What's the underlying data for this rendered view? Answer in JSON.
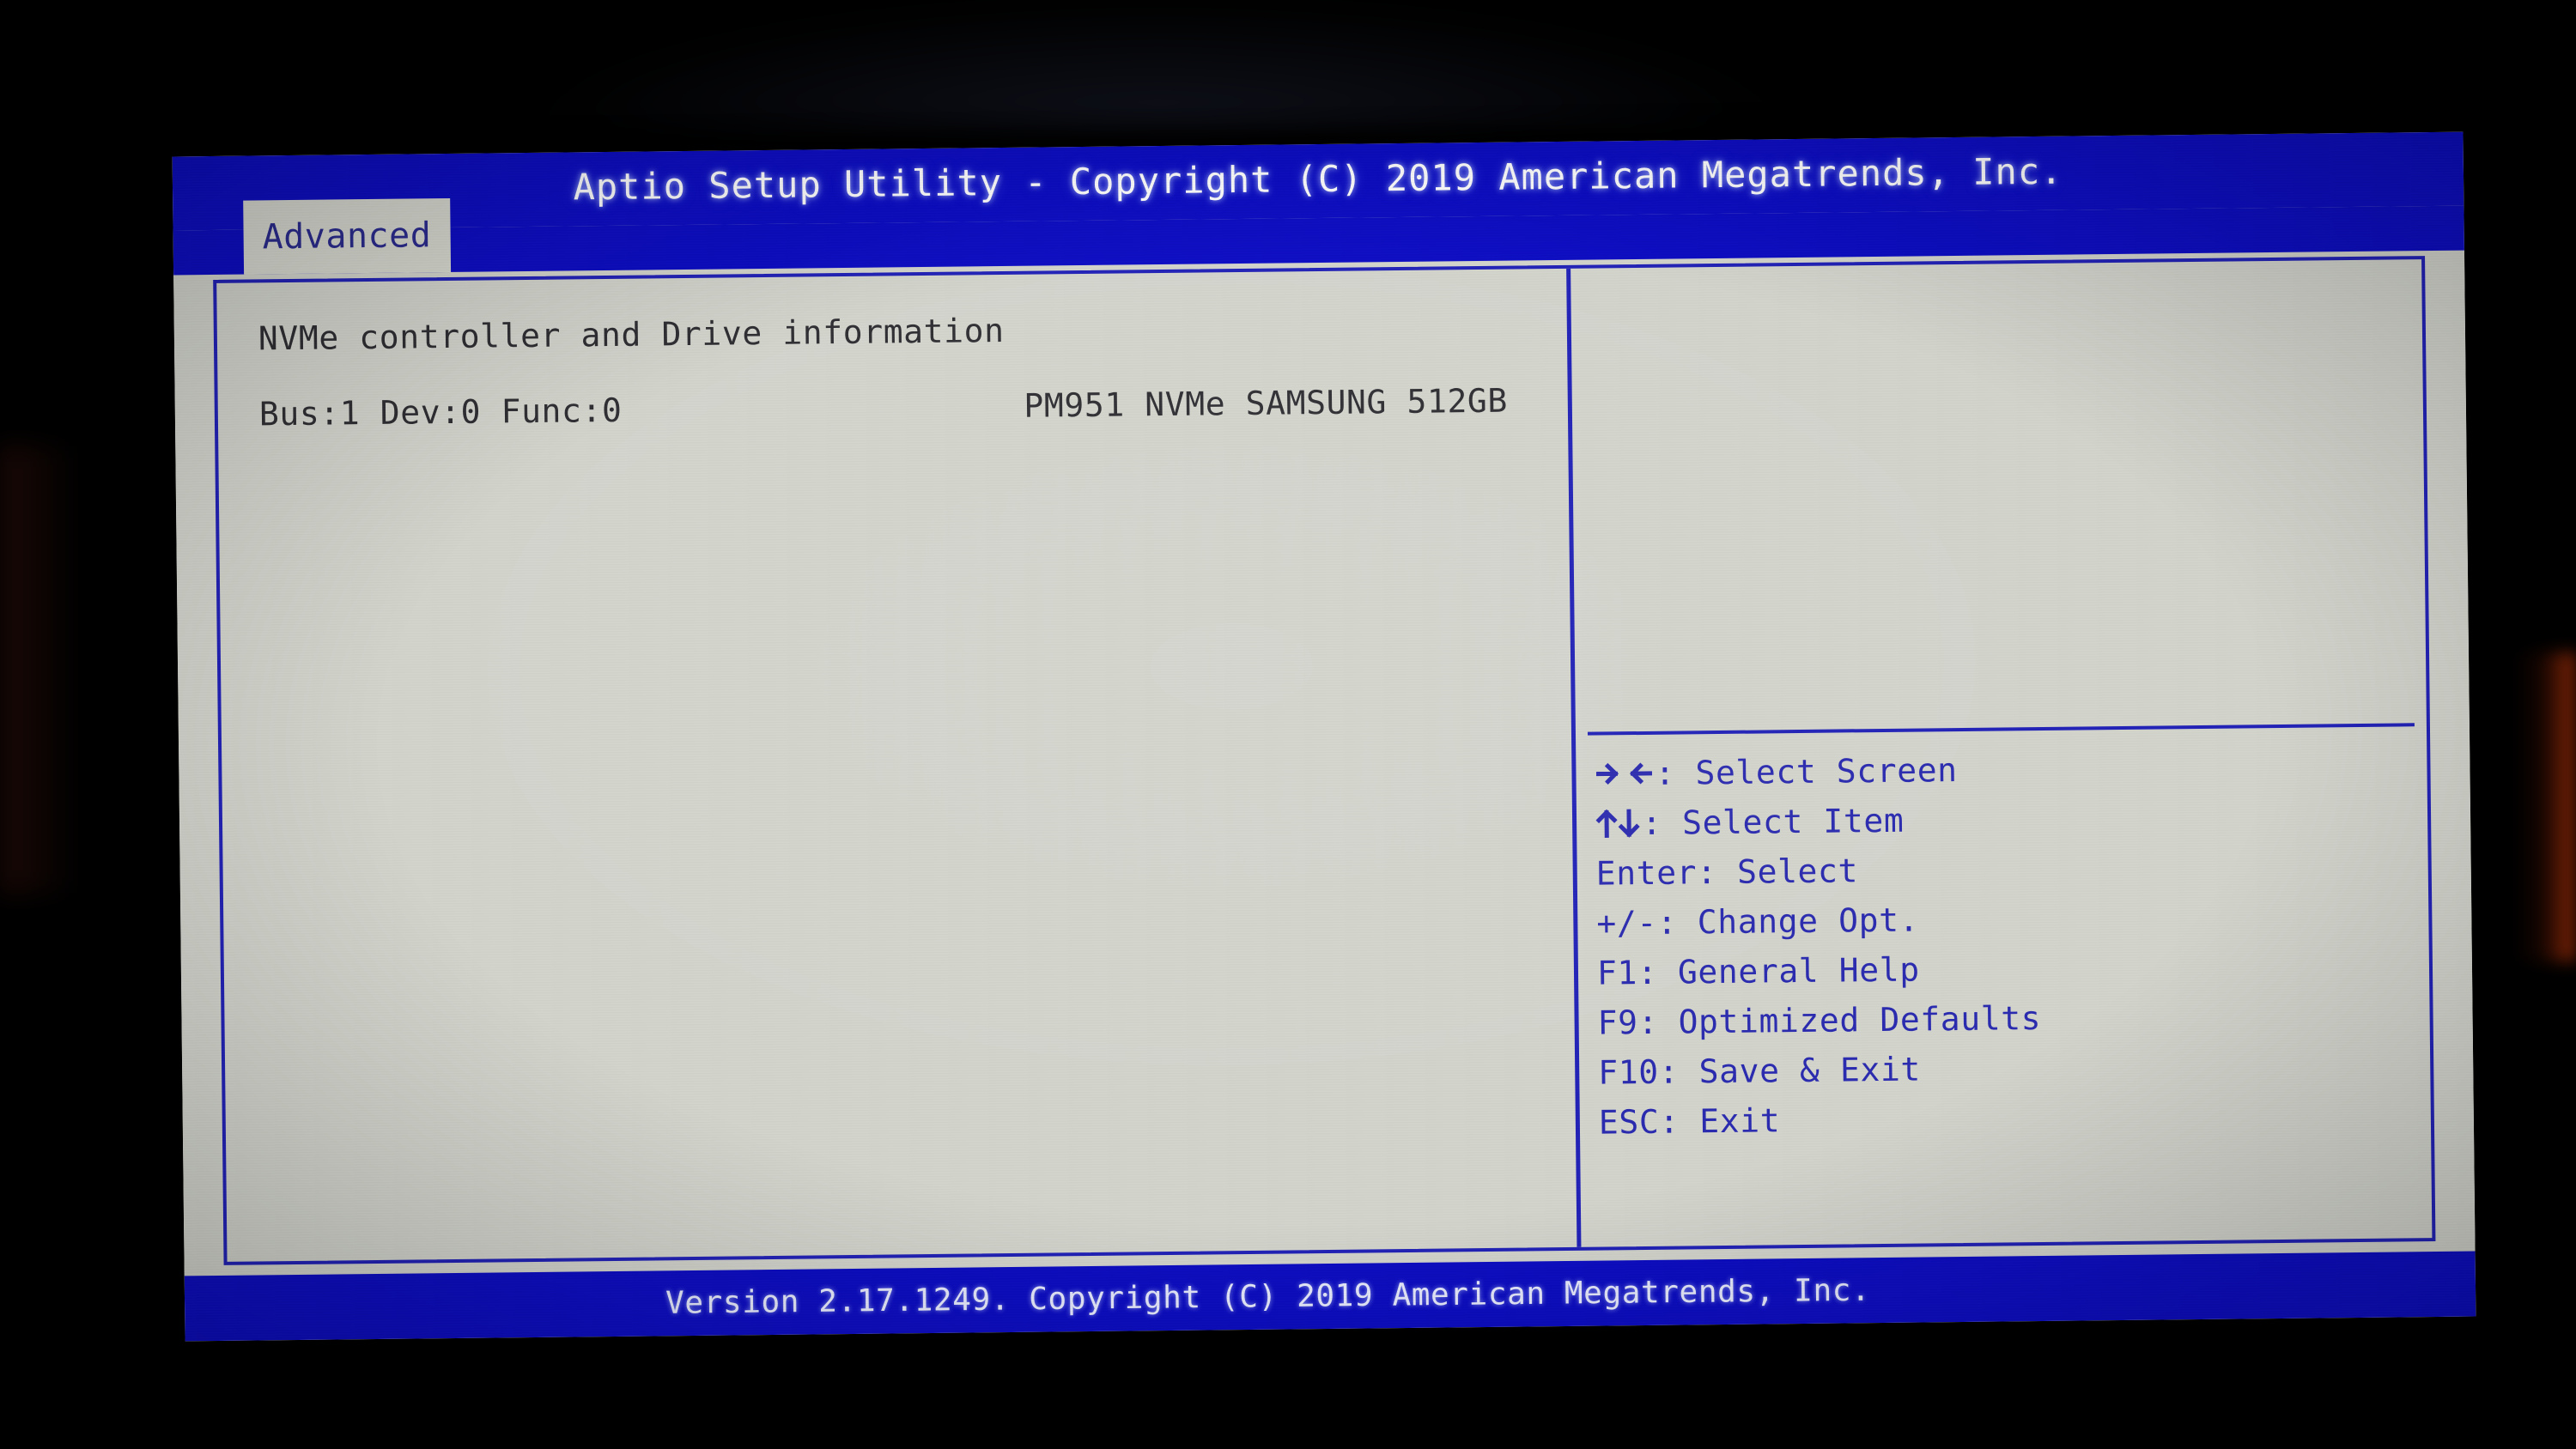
{
  "window": {
    "title": "Aptio Setup Utility - Copyright (C) 2019 American Megatrends, Inc."
  },
  "tabs": [
    {
      "id": "advanced",
      "label": "Advanced",
      "selected": true
    }
  ],
  "main": {
    "section_heading": "NVMe controller and Drive information",
    "device": {
      "locator": "Bus:1 Dev:0 Func:0",
      "name": "PM951 NVMe SAMSUNG 512GB"
    }
  },
  "help_panel": {
    "description": "",
    "keys": [
      {
        "icons": [
          "arrow-right-icon",
          "arrow-left-icon"
        ],
        "keys": "",
        "separator": ": ",
        "action": "Select Screen"
      },
      {
        "icons": [
          "arrow-up-icon",
          "arrow-down-icon"
        ],
        "keys": "",
        "separator": ": ",
        "action": "Select Item"
      },
      {
        "icons": [],
        "keys": "Enter",
        "separator": ": ",
        "action": "Select"
      },
      {
        "icons": [],
        "keys": "+/-",
        "separator": ": ",
        "action": "Change Opt."
      },
      {
        "icons": [],
        "keys": "F1",
        "separator": ": ",
        "action": "General Help"
      },
      {
        "icons": [],
        "keys": "F9",
        "separator": ": ",
        "action": "Optimized Defaults"
      },
      {
        "icons": [],
        "keys": "F10",
        "separator": ": ",
        "action": "Save & Exit"
      },
      {
        "icons": [],
        "keys": "ESC",
        "separator": ": ",
        "action": "Exit"
      }
    ]
  },
  "footer": {
    "version_text": "Version 2.17.1249. Copyright (C) 2019 American Megatrends, Inc."
  },
  "colors": {
    "bios_blue": "#0d0dc4",
    "frame_blue": "#2222b8",
    "text_blue": "#2b2bb0",
    "screen_bg": "#d3d5cd",
    "content_text": "#2e2e33",
    "title_text": "#ffffff",
    "photo_surround": "#000000"
  }
}
